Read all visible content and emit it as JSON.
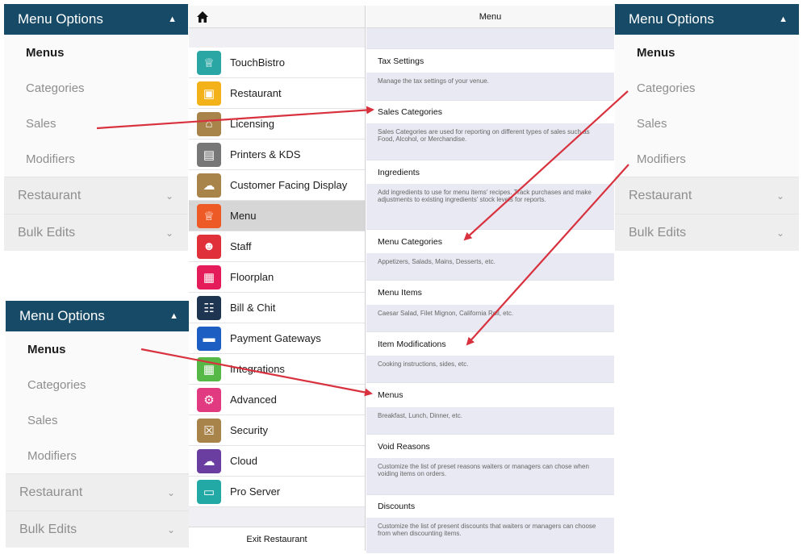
{
  "web_panels": [
    {
      "title": "Menu Options",
      "items": [
        "Menus",
        "Categories",
        "Sales",
        "Modifiers"
      ],
      "sections": [
        "Restaurant",
        "Bulk Edits"
      ]
    },
    {
      "title": "Menu Options",
      "items": [
        "Menus",
        "Categories",
        "Sales",
        "Modifiers"
      ],
      "sections": [
        "Restaurant",
        "Bulk Edits"
      ]
    },
    {
      "title": "Menu Options",
      "items": [
        "Menus",
        "Categories",
        "Sales",
        "Modifiers"
      ],
      "sections": [
        "Restaurant",
        "Bulk Edits"
      ]
    }
  ],
  "settings_list": {
    "items": [
      {
        "label": "TouchBistro",
        "icon": "touchbistro-chef-icon",
        "color": "#2aa7a5"
      },
      {
        "label": "Restaurant",
        "icon": "restaurant-storefront-icon",
        "color": "#f3b21a"
      },
      {
        "label": "Licensing",
        "icon": "licensing-cart-icon",
        "color": "#a8834a"
      },
      {
        "label": "Printers & KDS",
        "icon": "printer-icon",
        "color": "#777777"
      },
      {
        "label": "Customer Facing Display",
        "icon": "cfd-chef-hat-icon",
        "color": "#a8834a"
      },
      {
        "label": "Menu",
        "icon": "menu-chef-icon",
        "color": "#ee5a26"
      },
      {
        "label": "Staff",
        "icon": "staff-people-icon",
        "color": "#e0313a"
      },
      {
        "label": "Floorplan",
        "icon": "floorplan-icon",
        "color": "#e51c5a"
      },
      {
        "label": "Bill & Chit",
        "icon": "bill-receipt-icon",
        "color": "#1d3550"
      },
      {
        "label": "Payment Gateways",
        "icon": "credit-card-icon",
        "color": "#1d5ec2"
      },
      {
        "label": "Integrations",
        "icon": "integrations-grid-icon",
        "color": "#56b847"
      },
      {
        "label": "Advanced",
        "icon": "gears-icon",
        "color": "#e23a80"
      },
      {
        "label": "Security",
        "icon": "lock-icon",
        "color": "#a8834a"
      },
      {
        "label": "Cloud",
        "icon": "cloud-icon",
        "color": "#6a3da0"
      },
      {
        "label": "Pro Server",
        "icon": "monitor-icon",
        "color": "#22a9a6"
      }
    ],
    "selected_index": 5,
    "exit_label": "Exit Restaurant"
  },
  "menu_detail": {
    "title": "Menu",
    "rows": [
      {
        "label": "Tax Settings",
        "desc": "Manage the tax settings of your venue."
      },
      {
        "label": "Sales Categories",
        "desc": "Sales Categories are used for reporting on different types of sales such as Food, Alcohol, or Merchandise."
      },
      {
        "label": "Ingredients",
        "desc": "Add ingredients to use for menu items' recipes. Track purchases and make adjustments to existing ingredients' stock levels for reports."
      },
      {
        "label": "Menu Categories",
        "desc": "Appetizers, Salads, Mains, Desserts, etc."
      },
      {
        "label": "Menu Items",
        "desc": "Caesar Salad, Filet Mignon, California Roll, etc."
      },
      {
        "label": "Item Modifications",
        "desc": "Cooking instructions, sides, etc."
      },
      {
        "label": "Menus",
        "desc": "Breakfast, Lunch, Dinner, etc."
      },
      {
        "label": "Void Reasons",
        "desc": "Customize the list of preset reasons waiters or managers can chose when voiding items on orders."
      },
      {
        "label": "Discounts",
        "desc": "Customize the list of present discounts that waiters or managers can choose from when discounting items."
      }
    ]
  },
  "colors": {
    "header_navy": "#174a66",
    "arrow_red": "#d8323f"
  }
}
